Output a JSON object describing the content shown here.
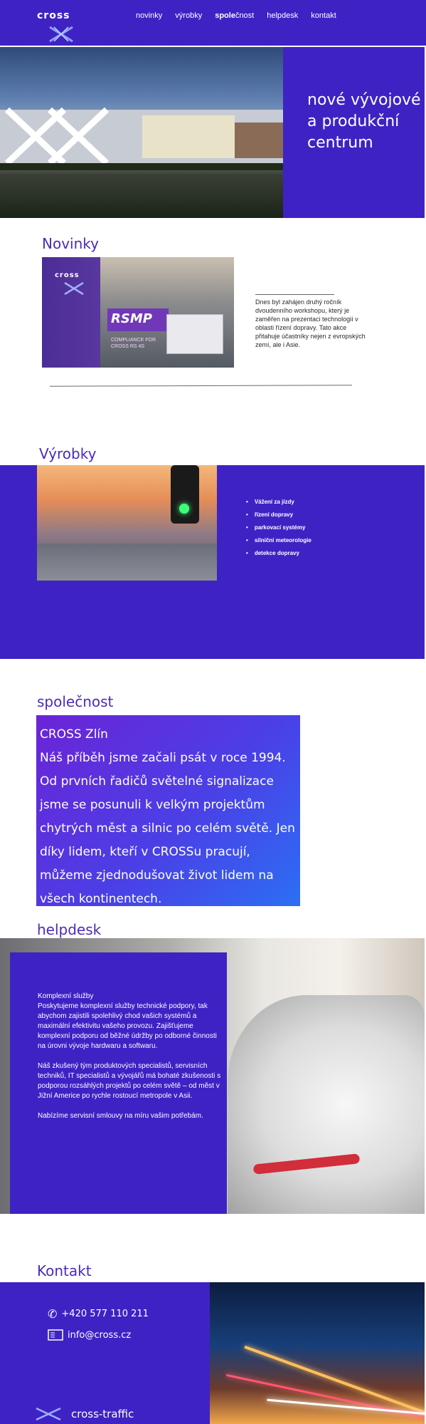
{
  "nav": {
    "logo": "cross",
    "links": [
      {
        "label": "novinky"
      },
      {
        "label": "výrobky"
      },
      {
        "label_strong": "spole",
        "label_rest": "čnost"
      },
      {
        "label": "helpdesk"
      },
      {
        "label": "kontakt"
      }
    ]
  },
  "hero": {
    "title": "nové vývojové a produkční centrum"
  },
  "novinky": {
    "title": "Novinky",
    "image": {
      "logo": "cross",
      "badge": "RSMP",
      "caption": "COMPLIANCE FOR CROSS RS 4S"
    },
    "text": "Dnes byl zahájen druhý ročník dvoudenního workshopu, který je zaměřen na prezentaci technologií v oblasti řízení dopravy. Tato akce přitahuje účastníky nejen z evropských zemí, ale i Asie."
  },
  "vyrobky": {
    "title": "Výrobky",
    "items": [
      "Vážení za jízdy",
      "řízení dopravy",
      "parkovací systémy",
      "silniční meteorologie",
      "detekce dopravy"
    ]
  },
  "spolecnost": {
    "title": "společnost",
    "text": "CROSS Zlín\nNáš příběh jsme začali psát v roce 1994. Od prvních řadičů světelné signalizace jsme se posunuli k velkým projektům chytrých měst a silnic po celém světě. Jen díky lidem, kteří v CROSSu pracují, můžeme zjednodušovat život lidem na všech kontinentech."
  },
  "helpdesk": {
    "title": "helpdesk",
    "paragraphs": [
      "Komplexní služby\nPoskytujeme komplexní služby technické podpory, tak abychom zajistili spolehlivý chod vašich systémů a maximální efektivitu vašeho provozu. Zajišťujeme komplexní podporu od běžné údržby po odborné činnosti na úrovni vývoje hardwaru a softwaru.",
      "Náš zkušený tým produktových specialistů, servisních techniků, IT specialistů a vývojářů má bohaté zkušenosti s podporou rozsáhlých projektů po celém světě – od měst v Jižní Americe po rychle rostoucí metropole v Asii.",
      "Nabízíme servisní smlouvy na míru vašim potřebám."
    ]
  },
  "kontakt": {
    "title": "Kontakt",
    "phone": "+420 577 110 211",
    "email": "info@cross.cz",
    "brand": "cross-traffic"
  },
  "colors": {
    "brand": "#3f22c4",
    "heading": "#4a2bbd"
  }
}
